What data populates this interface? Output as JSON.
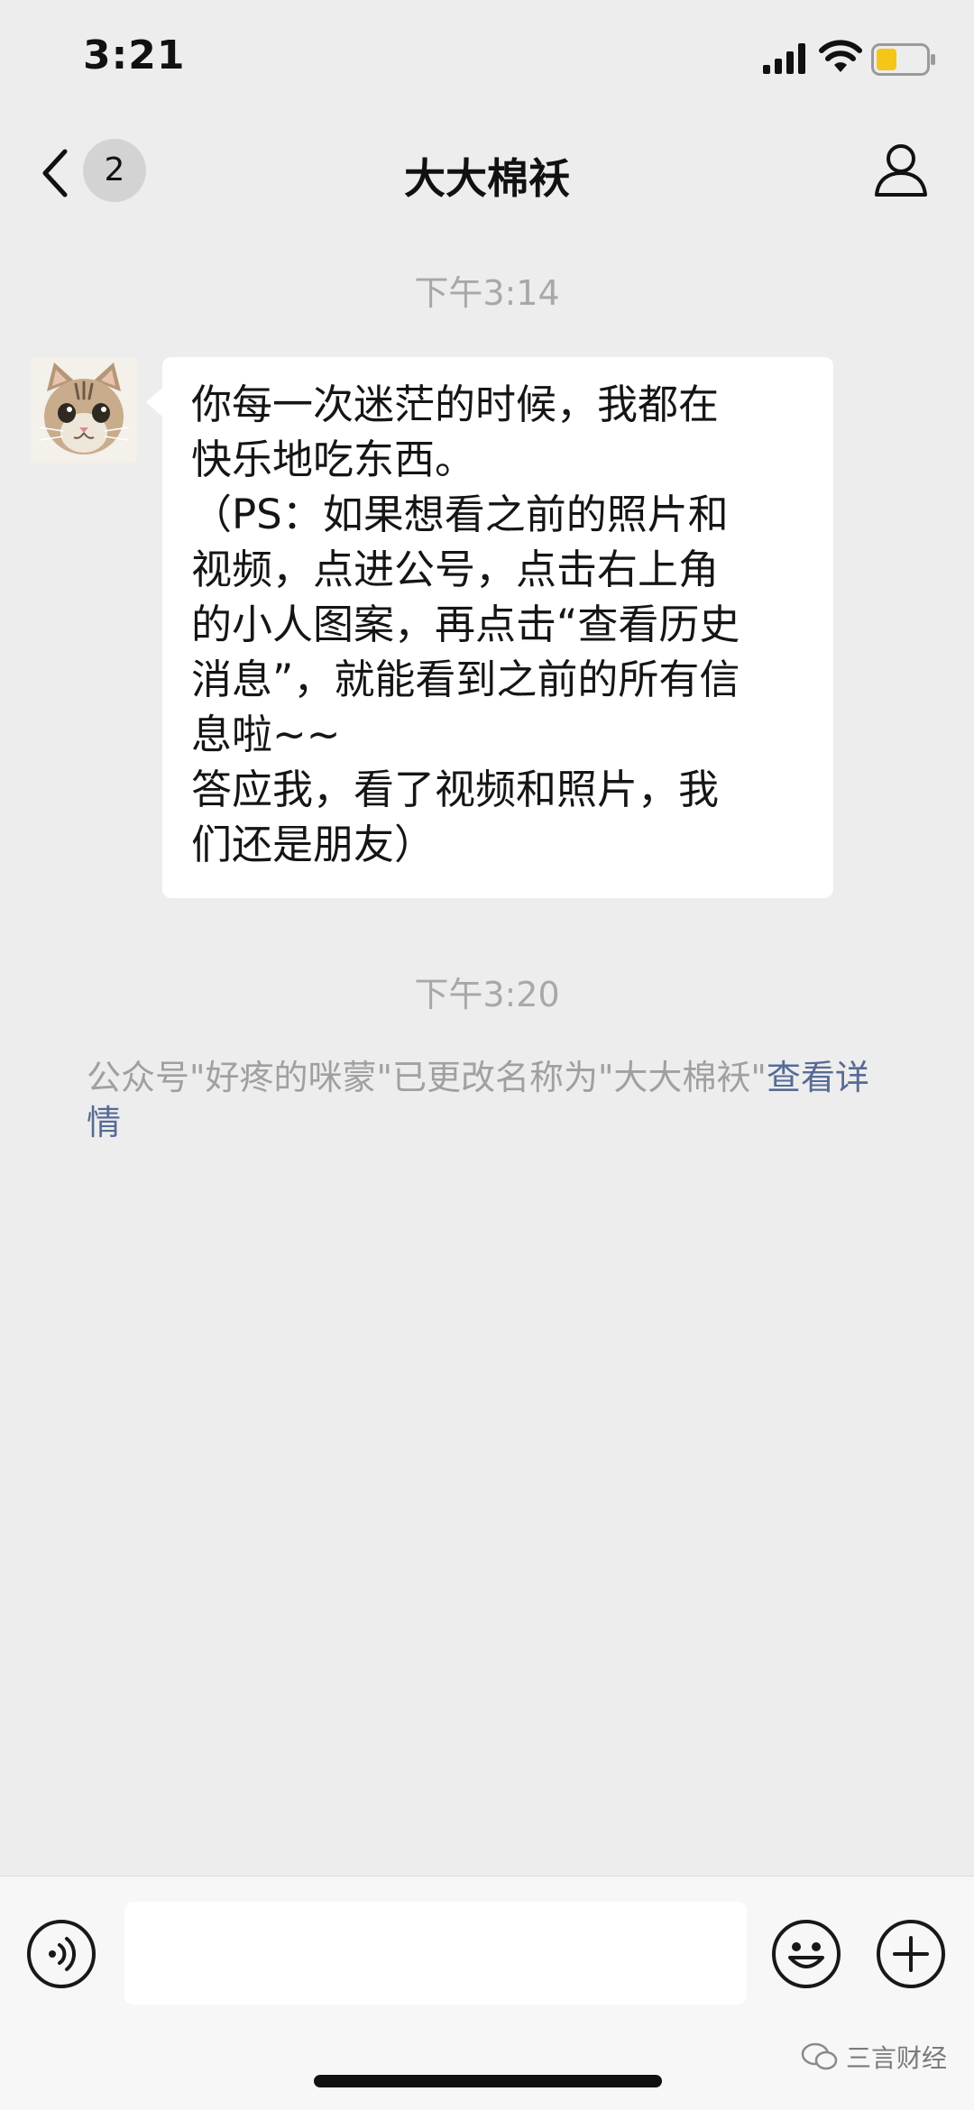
{
  "status_bar": {
    "time": "3:21"
  },
  "nav": {
    "unread_count": "2",
    "title": "大大棉袄"
  },
  "messages": {
    "timestamp_1": "下午3:14",
    "bubble_text": "你每一次迷茫的时候，我都在\n快乐地吃东西。\n（PS：如果想看之前的照片和\n视频，点进公号，点击右上角\n的小人图案，再点击“查看历史\n消息”，就能看到之前的所有信\n息啦~~\n答应我，看了视频和照片，我\n们还是朋友）",
    "timestamp_2": "下午3:20",
    "system_notice": "公众号\"好疼的咪蒙\"已更改名称为\"大大棉袄\"",
    "system_link": "查看详情"
  },
  "watermark": {
    "text": "三言财经"
  },
  "colors": {
    "background": "#EDEDED",
    "bubble": "#FFFFFF",
    "link": "#576B95",
    "battery_fill": "#F5C518"
  }
}
